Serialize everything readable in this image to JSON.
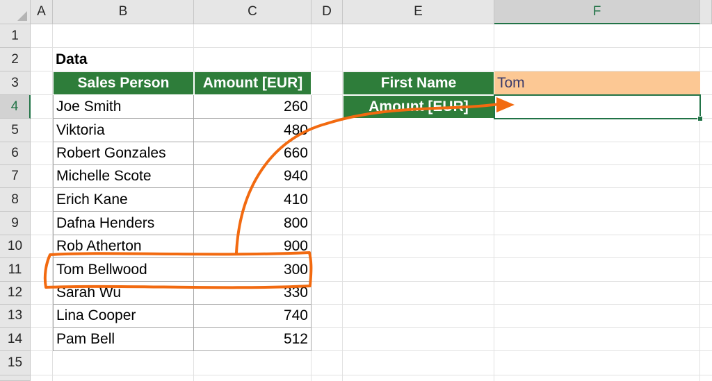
{
  "columns": [
    "A",
    "B",
    "C",
    "D",
    "E",
    "F"
  ],
  "rows": [
    "1",
    "2",
    "3",
    "4",
    "5",
    "6",
    "7",
    "8",
    "9",
    "10",
    "11",
    "12",
    "13",
    "14",
    "15"
  ],
  "data_label": "Data",
  "table": {
    "headers": [
      "Sales Person",
      "Amount [EUR]"
    ],
    "rows": [
      [
        "Joe Smith",
        "260"
      ],
      [
        "Viktoria",
        "480"
      ],
      [
        "Robert Gonzales",
        "660"
      ],
      [
        "Michelle Scote",
        "940"
      ],
      [
        "Erich Kane",
        "410"
      ],
      [
        "Dafna Henders",
        "800"
      ],
      [
        "Rob Atherton",
        "900"
      ],
      [
        "Tom Bellwood",
        "300"
      ],
      [
        "Sarah Wu",
        "330"
      ],
      [
        "Lina Cooper",
        "740"
      ],
      [
        "Pam Bell",
        "512"
      ]
    ]
  },
  "lookup": {
    "first_name_label": "First Name",
    "first_name_value": "Tom",
    "amount_label": "Amount [EUR]",
    "amount_value": ""
  },
  "selection": {
    "active_cell": "F4",
    "selected_column": "F",
    "selected_row": "4"
  },
  "colors": {
    "header_green": "#2e7d3a",
    "input_orange": "#fcc894",
    "annotation_orange": "#f26a10",
    "selection_green": "#217346"
  }
}
